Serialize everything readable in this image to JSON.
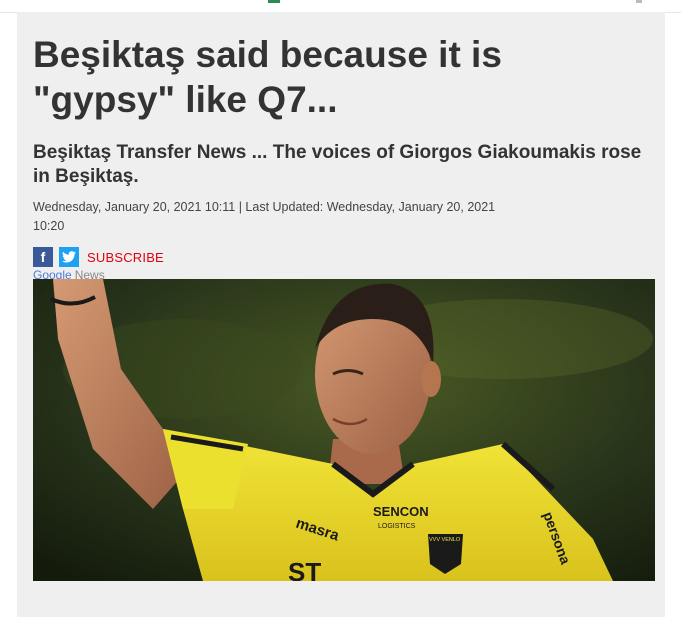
{
  "article": {
    "headline": "Beşiktaş said because it is \"gypsy\" like Q7...",
    "subheadline": "Beşiktaş Transfer News ... The voices of Giorgos Giakoumakis rose in Beşiktaş.",
    "date_line_1": "Wednesday, January 20, 2021 10:11 | Last Updated: Wednesday, January 20, 2021",
    "date_line_2": "10:20"
  },
  "share": {
    "facebook_glyph": "f",
    "twitter_glyph": "t",
    "subscribe_label": "SUBSCRIBE"
  },
  "google_news": {
    "google": "Google",
    "news": "News"
  },
  "photo": {
    "jersey_text_1": "SENCON",
    "jersey_text_2": "LOGISTICS",
    "sleeve_text": "masra",
    "side_text": "persona",
    "badge_text": "VVV VENLO"
  },
  "colors": {
    "panel_bg": "#efefef",
    "headline": "#333333",
    "facebook": "#3b5998",
    "twitter": "#1da1f2",
    "subscribe": "#e3000f",
    "jersey": "#f0e22a"
  }
}
